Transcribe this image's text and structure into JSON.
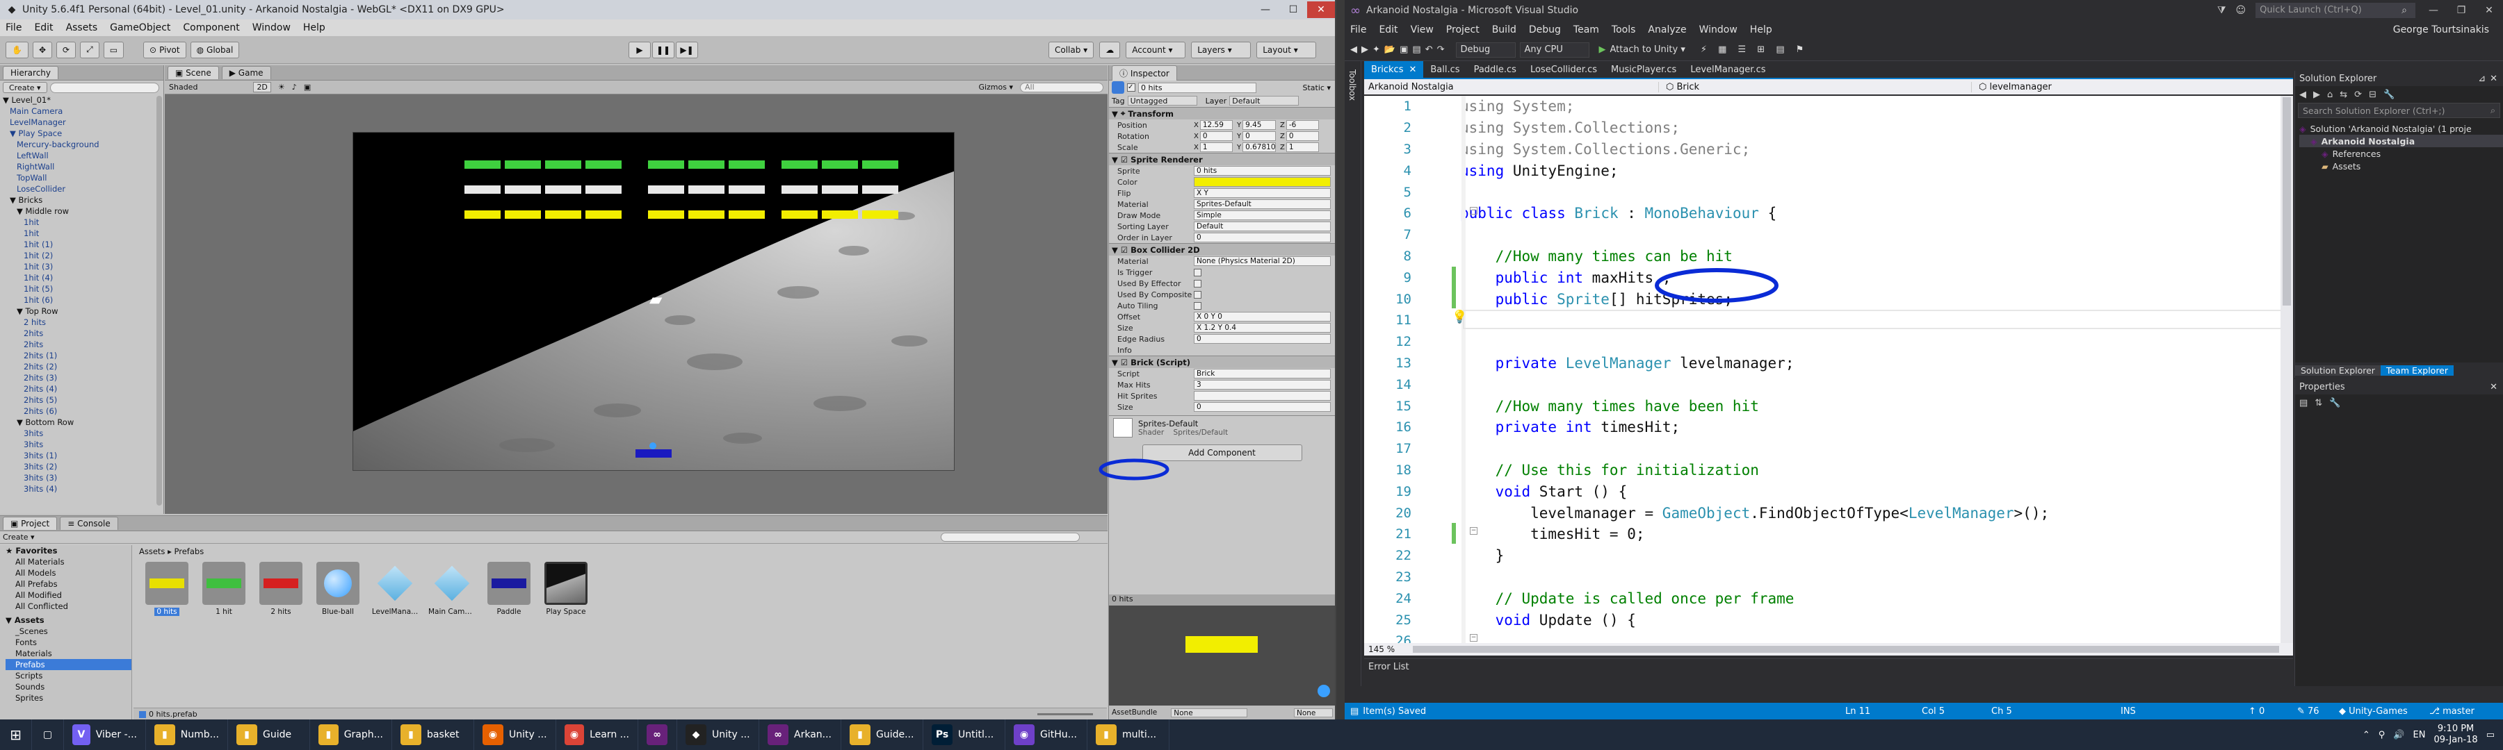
{
  "unity": {
    "title": "Unity 5.6.4f1 Personal (64bit) - Level_01.unity - Arkanoid Nostalgia - WebGL* <DX11 on DX9 GPU>",
    "menu": [
      "File",
      "Edit",
      "Assets",
      "GameObject",
      "Component",
      "Window",
      "Help"
    ],
    "toolbar": {
      "pivot": "Pivot",
      "global": "Global",
      "collab": "Collab ▾",
      "account": "Account ▾",
      "layers": "Layers ▾",
      "layout": "Layout ▾"
    },
    "hierarchy": {
      "tab": "Hierarchy",
      "create": "Create ▾",
      "search": "",
      "items": [
        {
          "label": "▼ Level_01*",
          "indent": 0,
          "black": true
        },
        {
          "label": "Main Camera",
          "indent": 1
        },
        {
          "label": "LevelManager",
          "indent": 1
        },
        {
          "label": "▼ Play Space",
          "indent": 1
        },
        {
          "label": "Mercury-background",
          "indent": 2
        },
        {
          "label": "LeftWall",
          "indent": 2
        },
        {
          "label": "RightWall",
          "indent": 2
        },
        {
          "label": "TopWall",
          "indent": 2
        },
        {
          "label": "LoseCollider",
          "indent": 2
        },
        {
          "label": "▼ Bricks",
          "indent": 1,
          "black": true
        },
        {
          "label": "▼ Middle row",
          "indent": 2,
          "black": true
        },
        {
          "label": "1hit",
          "indent": 3
        },
        {
          "label": "1hit",
          "indent": 3
        },
        {
          "label": "1hit (1)",
          "indent": 3
        },
        {
          "label": "1hit (2)",
          "indent": 3
        },
        {
          "label": "1hit (3)",
          "indent": 3
        },
        {
          "label": "1hit (4)",
          "indent": 3
        },
        {
          "label": "1hit (5)",
          "indent": 3
        },
        {
          "label": "1hit (6)",
          "indent": 3
        },
        {
          "label": "▼ Top Row",
          "indent": 2,
          "black": true
        },
        {
          "label": "2 hits",
          "indent": 3
        },
        {
          "label": "2hits",
          "indent": 3
        },
        {
          "label": "2hits",
          "indent": 3
        },
        {
          "label": "2hits (1)",
          "indent": 3
        },
        {
          "label": "2hits (2)",
          "indent": 3
        },
        {
          "label": "2hits (3)",
          "indent": 3
        },
        {
          "label": "2hits (4)",
          "indent": 3
        },
        {
          "label": "2hits (5)",
          "indent": 3
        },
        {
          "label": "2hits (6)",
          "indent": 3
        },
        {
          "label": "▼ Bottom Row",
          "indent": 2,
          "black": true
        },
        {
          "label": "3hits",
          "indent": 3
        },
        {
          "label": "3hits",
          "indent": 3
        },
        {
          "label": "3hits (1)",
          "indent": 3
        },
        {
          "label": "3hits (2)",
          "indent": 3
        },
        {
          "label": "3hits (3)",
          "indent": 3
        },
        {
          "label": "3hits (4)",
          "indent": 3
        }
      ]
    },
    "scene": {
      "tab_scene": "Scene",
      "tab_game": "Game",
      "shaded": "Shaded",
      "mode2d": "2D",
      "gizmos": "Gizmos ▾",
      "search": "All"
    },
    "inspector": {
      "tab": "Inspector",
      "object_name": "0 hits",
      "static": "Static ▾",
      "tag_label": "Tag",
      "tag": "Untagged",
      "layer_label": "Layer",
      "layer": "Default",
      "transform": {
        "title": "Transform",
        "rows": [
          {
            "label": "Position",
            "x": "12.59",
            "y": "9.45",
            "z": "-6"
          },
          {
            "label": "Rotation",
            "x": "0",
            "y": "0",
            "z": "0"
          },
          {
            "label": "Scale",
            "x": "1",
            "y": "0.67810",
            "z": "1"
          }
        ]
      },
      "sprite_renderer": {
        "title": "Sprite Renderer",
        "rows": [
          {
            "label": "Sprite",
            "value": "0 hits"
          },
          {
            "label": "Color",
            "value": ""
          },
          {
            "label": "Flip",
            "value": "X  Y"
          },
          {
            "label": "Material",
            "value": "Sprites-Default"
          },
          {
            "label": "Draw Mode",
            "value": "Simple"
          },
          {
            "label": "Sorting Layer",
            "value": "Default"
          },
          {
            "label": "Order in Layer",
            "value": "0"
          }
        ]
      },
      "box_collider": {
        "title": "Box Collider 2D",
        "rows": [
          {
            "label": "Material",
            "value": "None (Physics Material 2D)"
          },
          {
            "label": "Is Trigger",
            "value": ""
          },
          {
            "label": "Used By Effector",
            "value": ""
          },
          {
            "label": "Used By Composite",
            "value": ""
          },
          {
            "label": "Auto Tiling",
            "value": ""
          },
          {
            "label": "Offset",
            "value": "X 0      Y 0"
          },
          {
            "label": "Size",
            "value": "X 1.2    Y 0.4"
          },
          {
            "label": "Edge Radius",
            "value": "0"
          },
          {
            "label": "Info",
            "value": ""
          }
        ]
      },
      "brick_script": {
        "title": "Brick (Script)",
        "rows": [
          {
            "label": "Script",
            "value": "Brick"
          },
          {
            "label": "Max Hits",
            "value": "3"
          },
          {
            "label": "Hit Sprites",
            "value": ""
          },
          {
            "label": "Size",
            "value": "0"
          }
        ]
      },
      "material": {
        "name": "Sprites-Default",
        "shader_label": "Shader",
        "shader": "Sprites/Default"
      },
      "add_component": "Add Component",
      "preview_title": "0 hits",
      "asset_bundle_label": "AssetBundle",
      "asset_bundle": "None",
      "asset_bundle_variant": "None"
    },
    "project": {
      "tab_project": "Project",
      "tab_console": "Console",
      "create": "Create ▾",
      "favorites": [
        "★ Favorites",
        "All Materials",
        "All Models",
        "All Prefabs",
        "All Modified",
        "All Conflicted"
      ],
      "assets_tree": [
        "▼ Assets",
        "_Scenes",
        "Fonts",
        "Materials",
        "Prefabs",
        "Scripts",
        "Sounds",
        "Sprites"
      ],
      "breadcrumb": "Assets ▸ Prefabs",
      "assets": [
        {
          "name": "0 hits",
          "color": "#e8e000",
          "kind": "brick"
        },
        {
          "name": "1 hit",
          "color": "#3fbf3f",
          "kind": "brick"
        },
        {
          "name": "2 hits",
          "color": "#d62020",
          "kind": "brick"
        },
        {
          "name": "Blue-ball",
          "color": "#3aa0ff",
          "kind": "ball"
        },
        {
          "name": "LevelMana...",
          "color": "#5ab0e0",
          "kind": "cube"
        },
        {
          "name": "Main Came...",
          "color": "#5ab0e0",
          "kind": "cube"
        },
        {
          "name": "Paddle",
          "color": "#1a1aa0",
          "kind": "brick"
        },
        {
          "name": "Play Space",
          "color": "#333333",
          "kind": "space"
        }
      ],
      "footer": "0 hits.prefab"
    }
  },
  "vs": {
    "title": "Arkanoid Nostalgia - Microsoft Visual Studio",
    "quick_launch": "Quick Launch (Ctrl+Q)",
    "user": "George Tourtsinakis",
    "menu": [
      "File",
      "Edit",
      "View",
      "Project",
      "Build",
      "Debug",
      "Team",
      "Tools",
      "Analyze",
      "Window",
      "Help"
    ],
    "config": "Debug",
    "platform": "Any CPU",
    "attach": "Attach to Unity ▾",
    "tabs": [
      "Brickcs",
      "Ball.cs",
      "Paddle.cs",
      "LoseCollider.cs",
      "MusicPlayer.cs",
      "LevelManager.cs"
    ],
    "nav": {
      "project": "Arkanoid Nostalgia",
      "class": "Brick",
      "member": "levelmanager"
    },
    "zoom": "145 %",
    "error_list": "Error List",
    "status": {
      "saved": "Item(s) Saved",
      "ln": "Ln 11",
      "col": "Col 5",
      "ch": "Ch 5",
      "ins": "INS",
      "up": "0",
      "pencil": "76",
      "repo": "Unity-Games",
      "branch": "master"
    },
    "solution_explorer": {
      "title": "Solution Explorer",
      "search": "Search Solution Explorer (Ctrl+;)",
      "items": [
        {
          "label": "Solution 'Arkanoid Nostalgia' (1 proje",
          "indent": 0
        },
        {
          "label": "Arkanoid Nostalgia",
          "indent": 1,
          "bold": true
        },
        {
          "label": "References",
          "indent": 2
        },
        {
          "label": "Assets",
          "indent": 2
        }
      ],
      "tab1": "Solution Explorer",
      "tab2": "Team Explorer"
    },
    "properties_title": "Properties",
    "toolbox": "Toolbox"
  },
  "code": [
    [
      {
        "t": "using System;",
        "c": "gr"
      }
    ],
    [
      {
        "t": "using System.Collections;",
        "c": "gr"
      }
    ],
    [
      {
        "t": "using System.Collections.Generic;",
        "c": "gr"
      }
    ],
    [
      {
        "t": "using",
        "c": "kw"
      },
      {
        "t": " UnityEngine;",
        "c": ""
      }
    ],
    [
      {
        "t": "",
        "c": ""
      }
    ],
    [
      {
        "t": "public",
        "c": "kw"
      },
      {
        "t": " ",
        "c": ""
      },
      {
        "t": "class",
        "c": "kw"
      },
      {
        "t": " ",
        "c": ""
      },
      {
        "t": "Brick",
        "c": "ty"
      },
      {
        "t": " : ",
        "c": ""
      },
      {
        "t": "MonoBehaviour",
        "c": "ty"
      },
      {
        "t": " {",
        "c": ""
      }
    ],
    [
      {
        "t": "",
        "c": ""
      }
    ],
    [
      {
        "t": "    //How many times can be hit",
        "c": "cm"
      }
    ],
    [
      {
        "t": "    ",
        "c": ""
      },
      {
        "t": "public",
        "c": "kw"
      },
      {
        "t": " ",
        "c": ""
      },
      {
        "t": "int",
        "c": "kw"
      },
      {
        "t": " maxHits ;",
        "c": ""
      }
    ],
    [
      {
        "t": "    ",
        "c": ""
      },
      {
        "t": "public",
        "c": "kw"
      },
      {
        "t": " ",
        "c": ""
      },
      {
        "t": "Sprite",
        "c": "ty"
      },
      {
        "t": "[] hitSprites;",
        "c": ""
      }
    ],
    [
      {
        "t": "",
        "c": ""
      }
    ],
    [
      {
        "t": "",
        "c": ""
      }
    ],
    [
      {
        "t": "    ",
        "c": ""
      },
      {
        "t": "private",
        "c": "kw"
      },
      {
        "t": " ",
        "c": ""
      },
      {
        "t": "LevelManager",
        "c": "ty"
      },
      {
        "t": " levelmanager;",
        "c": ""
      }
    ],
    [
      {
        "t": "",
        "c": ""
      }
    ],
    [
      {
        "t": "    //How many times have been hit",
        "c": "cm"
      }
    ],
    [
      {
        "t": "    ",
        "c": ""
      },
      {
        "t": "private",
        "c": "kw"
      },
      {
        "t": " ",
        "c": ""
      },
      {
        "t": "int",
        "c": "kw"
      },
      {
        "t": " timesHit;",
        "c": ""
      }
    ],
    [
      {
        "t": "",
        "c": ""
      }
    ],
    [
      {
        "t": "    // Use this for initialization",
        "c": "cm"
      }
    ],
    [
      {
        "t": "    ",
        "c": ""
      },
      {
        "t": "void",
        "c": "kw"
      },
      {
        "t": " Start () {",
        "c": ""
      }
    ],
    [
      {
        "t": "        levelmanager = ",
        "c": ""
      },
      {
        "t": "GameObject",
        "c": "ty"
      },
      {
        "t": ".FindObjectOfType<",
        "c": ""
      },
      {
        "t": "LevelManager",
        "c": "ty"
      },
      {
        "t": ">();",
        "c": ""
      }
    ],
    [
      {
        "t": "        timesHit = 0;",
        "c": ""
      }
    ],
    [
      {
        "t": "    }",
        "c": ""
      }
    ],
    [
      {
        "t": "",
        "c": ""
      }
    ],
    [
      {
        "t": "    // Update is called once per frame",
        "c": "cm"
      }
    ],
    [
      {
        "t": "    ",
        "c": ""
      },
      {
        "t": "void",
        "c": "kw"
      },
      {
        "t": " Update () {",
        "c": ""
      }
    ],
    [
      {
        "t": "",
        "c": ""
      }
    ]
  ],
  "taskbar": {
    "items": [
      {
        "label": "Viber -...",
        "color": "#7360f2",
        "glyph": "V"
      },
      {
        "label": "Numb...",
        "color": "#e8b12b",
        "glyph": "▮"
      },
      {
        "label": "Guide",
        "color": "#e8b12b",
        "glyph": "▮"
      },
      {
        "label": "Graph...",
        "color": "#e8b12b",
        "glyph": "▮"
      },
      {
        "label": "basket",
        "color": "#e8b12b",
        "glyph": "▮"
      },
      {
        "label": "Unity ...",
        "color": "#e66000",
        "glyph": "◉"
      },
      {
        "label": "Learn ...",
        "color": "#db4437",
        "glyph": "◉"
      },
      {
        "label": "",
        "color": "#68217a",
        "glyph": "∞"
      },
      {
        "label": "Unity ...",
        "color": "#222222",
        "glyph": "◆"
      },
      {
        "label": "Arkan...",
        "color": "#68217a",
        "glyph": "∞"
      },
      {
        "label": "Guide...",
        "color": "#e8b12b",
        "glyph": "▮"
      },
      {
        "label": "Untitl...",
        "color": "#001e36",
        "glyph": "Ps"
      },
      {
        "label": "GitHu...",
        "color": "#6e40c9",
        "glyph": "◉"
      },
      {
        "label": "multi...",
        "color": "#e8b12b",
        "glyph": "▮"
      }
    ],
    "lang": "EN",
    "time": "9:10 PM",
    "date": "09-Jan-18"
  },
  "colors": {
    "vs_accent": "#007acc",
    "annotation": "#0a2bd6",
    "brick_green": "#3fd13f",
    "brick_yellow": "#f2ee00"
  }
}
